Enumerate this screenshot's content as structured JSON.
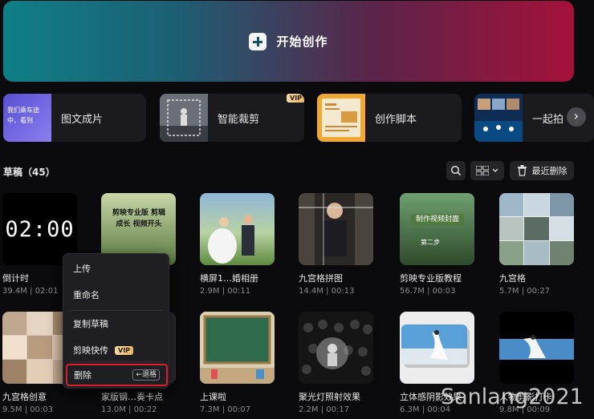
{
  "hero": {
    "label": "开始创作",
    "icon": "plus-icon"
  },
  "tools": [
    {
      "label": "图文成片",
      "thumb_text": "我们乘车途中，看到",
      "vip": false
    },
    {
      "label": "智能裁剪",
      "vip": true
    },
    {
      "label": "创作脚本",
      "vip": false
    },
    {
      "label": "一起拍",
      "vip": false
    }
  ],
  "vip_label": "VIP",
  "drafts": {
    "title": "草稿（45）",
    "recent_delete_label": "最近删除",
    "items": [
      {
        "name": "倒计时",
        "meta": "39.4M | 02:01",
        "thumb_text": "02:00"
      },
      {
        "name": "",
        "meta": "",
        "thumb_text": "剪映专业版 剪辑成长 视频开头"
      },
      {
        "name": "横屏1…婚相册",
        "meta": "2.9M | 00:11"
      },
      {
        "name": "九宫格拼图",
        "meta": "14.4M | 00:13"
      },
      {
        "name": "剪映专业版教程",
        "meta": "56.7M | 00:03",
        "thumb_text": "制作视频封面",
        "thumb_sub": "第二步"
      },
      {
        "name": "九宫格",
        "meta": "5.7M | 00:27"
      },
      {
        "name": "九宫格创意",
        "meta": "9.5M | 00:03"
      },
      {
        "name": "家版钢…奏卡点",
        "meta": "13.0M | 00:22"
      },
      {
        "name": "上课啦",
        "meta": "7.3M | 00:07"
      },
      {
        "name": "聚光灯照射效果",
        "meta": "2.2M | 00:17"
      },
      {
        "name": "立体感阴影效果",
        "meta": "6.3M | 00:04"
      },
      {
        "name": "人物剪影打卡",
        "meta": "9.8M | 00:09"
      }
    ]
  },
  "context_menu": {
    "items": [
      {
        "label": "上传"
      },
      {
        "label": "重命名"
      },
      {
        "label": "复制草稿"
      },
      {
        "label": "剪映快传",
        "vip": true
      },
      {
        "label": "删除",
        "shortcut": "←退格"
      }
    ]
  },
  "watermark": "Sanlang2021",
  "colors": {
    "accent_red": "#d6202a",
    "vip_gold": "#e9b765",
    "bg": "#0b0b0d"
  }
}
